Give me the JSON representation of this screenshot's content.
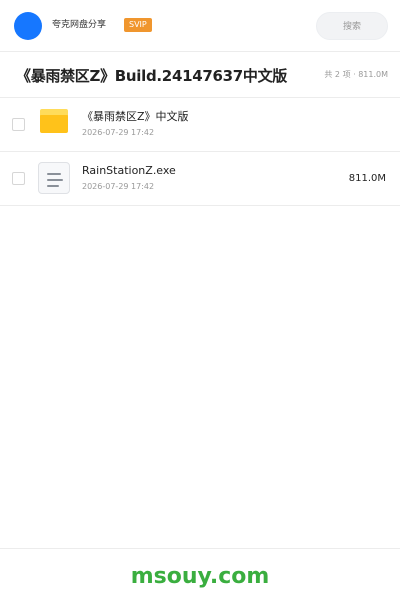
{
  "header": {
    "user_name": "夸克网盘分享",
    "vip_badge": "SVIP",
    "search_placeholder": "搜索"
  },
  "share": {
    "title": "《暴雨禁区Z》Build.24147637中文版",
    "count_info": "共 2 项 · 811.0M"
  },
  "files": [
    {
      "name": "《暴雨禁区Z》中文版",
      "date": "2026-07-29 17:42",
      "size": "",
      "icon": "folder-icon"
    },
    {
      "name": "RainStationZ.exe",
      "date": "2026-07-29 17:42",
      "size": "811.0M",
      "icon": "file-icon"
    }
  ],
  "footer": {
    "watermark": "msouy.com"
  },
  "colors": {
    "avatar": "#1677ff",
    "vip_badge": "#f0962e",
    "folder": "#ffc21a",
    "watermark": "#3aae3f"
  }
}
